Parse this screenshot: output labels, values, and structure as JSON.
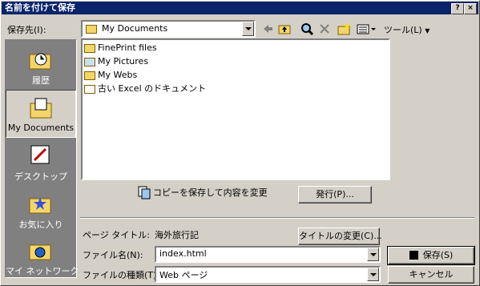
{
  "window": {
    "title": "名前を付けて保存",
    "help_label": "?",
    "close_label": "×"
  },
  "save_in": {
    "label": "保存先(I):",
    "value": "My Documents"
  },
  "toolbar": {
    "back_icon": "back-arrow-icon",
    "up_icon": "up-folder-icon",
    "search_icon": "search-web-icon",
    "delete_icon": "delete-icon",
    "new_folder_icon": "new-folder-icon",
    "views_icon": "views-icon",
    "tools_label": "ツール(L)"
  },
  "places": [
    {
      "label": "履歴",
      "icon": "history-icon",
      "selected": false
    },
    {
      "label": "My Documents",
      "icon": "my-documents-icon",
      "selected": true
    },
    {
      "label": "デスクトップ",
      "icon": "desktop-icon",
      "selected": false
    },
    {
      "label": "お気に入り",
      "icon": "favorites-icon",
      "selected": false
    },
    {
      "label": "マイ ネットワーク",
      "icon": "network-icon",
      "selected": false
    }
  ],
  "files": [
    {
      "name": "FinePrint files",
      "icon": "folder-icon"
    },
    {
      "name": "My Pictures",
      "icon": "pictures-folder-icon"
    },
    {
      "name": "My Webs",
      "icon": "folder-icon"
    },
    {
      "name": "古い Excel のドキュメント",
      "icon": "shortcut-folder-icon"
    }
  ],
  "copy_note": "コピーを保存して内容を変更",
  "publish_button": "発行(P)...",
  "page_title": {
    "label": "ページ タイトル:",
    "value": "海外旅行記",
    "change_button": "タイトルの変更(C)..."
  },
  "file_name": {
    "label": "ファイル名(N):",
    "value": "index.html"
  },
  "file_type": {
    "label": "ファイルの種類(T):",
    "value": "Web ページ"
  },
  "save_button": "保存(S)",
  "cancel_button": "キャンセル"
}
